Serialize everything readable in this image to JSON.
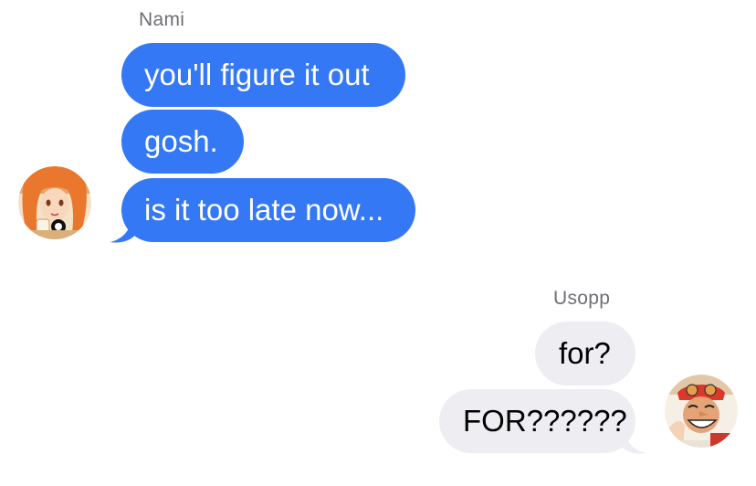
{
  "thread": {
    "group1": {
      "sender": "Nami",
      "messages": [
        "you'll figure it out",
        "gosh.",
        "is it too late now..."
      ]
    },
    "group2": {
      "sender": "Usopp",
      "messages": [
        "for?",
        "FOR??????"
      ]
    }
  },
  "colors": {
    "blue_bubble": "#3478f6",
    "gray_bubble": "#eeeef2",
    "sender_name": "#6e6e73"
  },
  "icons": {
    "avatar_1": "nami-avatar",
    "avatar_2": "usopp-avatar"
  }
}
